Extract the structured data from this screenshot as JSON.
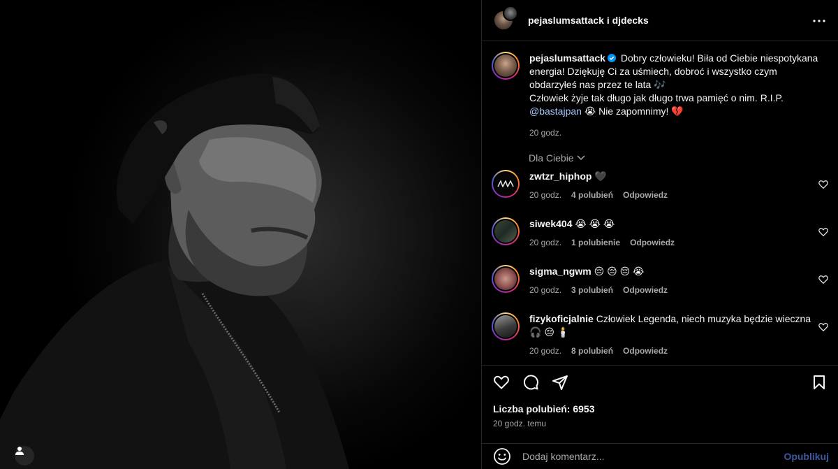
{
  "post": {
    "header_title": "pejaslumsattack i djdecks",
    "caption": {
      "username": "pejaslumsattack",
      "text_1": "Dobry człowieku! Biła od Ciebie niespotykana energia! Dziękuję Ci za uśmiech, dobroć i wszystko czym obdarzyłeś nas przez te lata",
      "emoji_1": "🎶",
      "text_2": "Człowiek żyje tak długo jak długo trwa pamięć o nim. R.I.P.",
      "mention": "@bastajpan",
      "emoji_2": "😭",
      "text_3": "Nie zapomnimy!",
      "emoji_3": "💔",
      "time": "20 godz."
    },
    "sort_label": "Dla Ciebie",
    "comments": [
      {
        "username": "zwtzr_hiphop",
        "text": "🖤",
        "time": "20 godz.",
        "likes": "4 polubień",
        "reply": "Odpowiedz"
      },
      {
        "username": "siwek404",
        "text": "😭 😭 😭",
        "time": "20 godz.",
        "likes": "1 polubienie",
        "reply": "Odpowiedz"
      },
      {
        "username": "sigma_ngwm",
        "text": "😔 😔 😔 😭",
        "time": "20 godz.",
        "likes": "3 polubień",
        "reply": "Odpowiedz"
      },
      {
        "username": "fizykoficjalnie",
        "text": "Człowiek Legenda, niech muzyka będzie wieczna",
        "text_2": "🎧 😔 🕯️",
        "time": "20 godz.",
        "likes": "8 polubień",
        "reply": "Odpowiedz"
      }
    ],
    "likes_count": "Liczba polubień: 6953",
    "posted_time": "20 godz. temu",
    "composer": {
      "placeholder": "Dodaj komentarz...",
      "publish": "Opublikuj"
    }
  },
  "icons": {
    "more": "more-horizontal-icon",
    "verified": "verified-badge-icon",
    "chevron": "chevron-down-icon",
    "like": "heart-outline-icon",
    "comment": "comment-bubble-icon",
    "share": "paper-plane-icon",
    "save": "bookmark-icon",
    "emoji": "smiley-icon",
    "user": "person-icon"
  },
  "colors": {
    "background": "#000000",
    "secondary_text": "#a8a8a8",
    "verified": "#0095f6",
    "divider": "#262626"
  }
}
